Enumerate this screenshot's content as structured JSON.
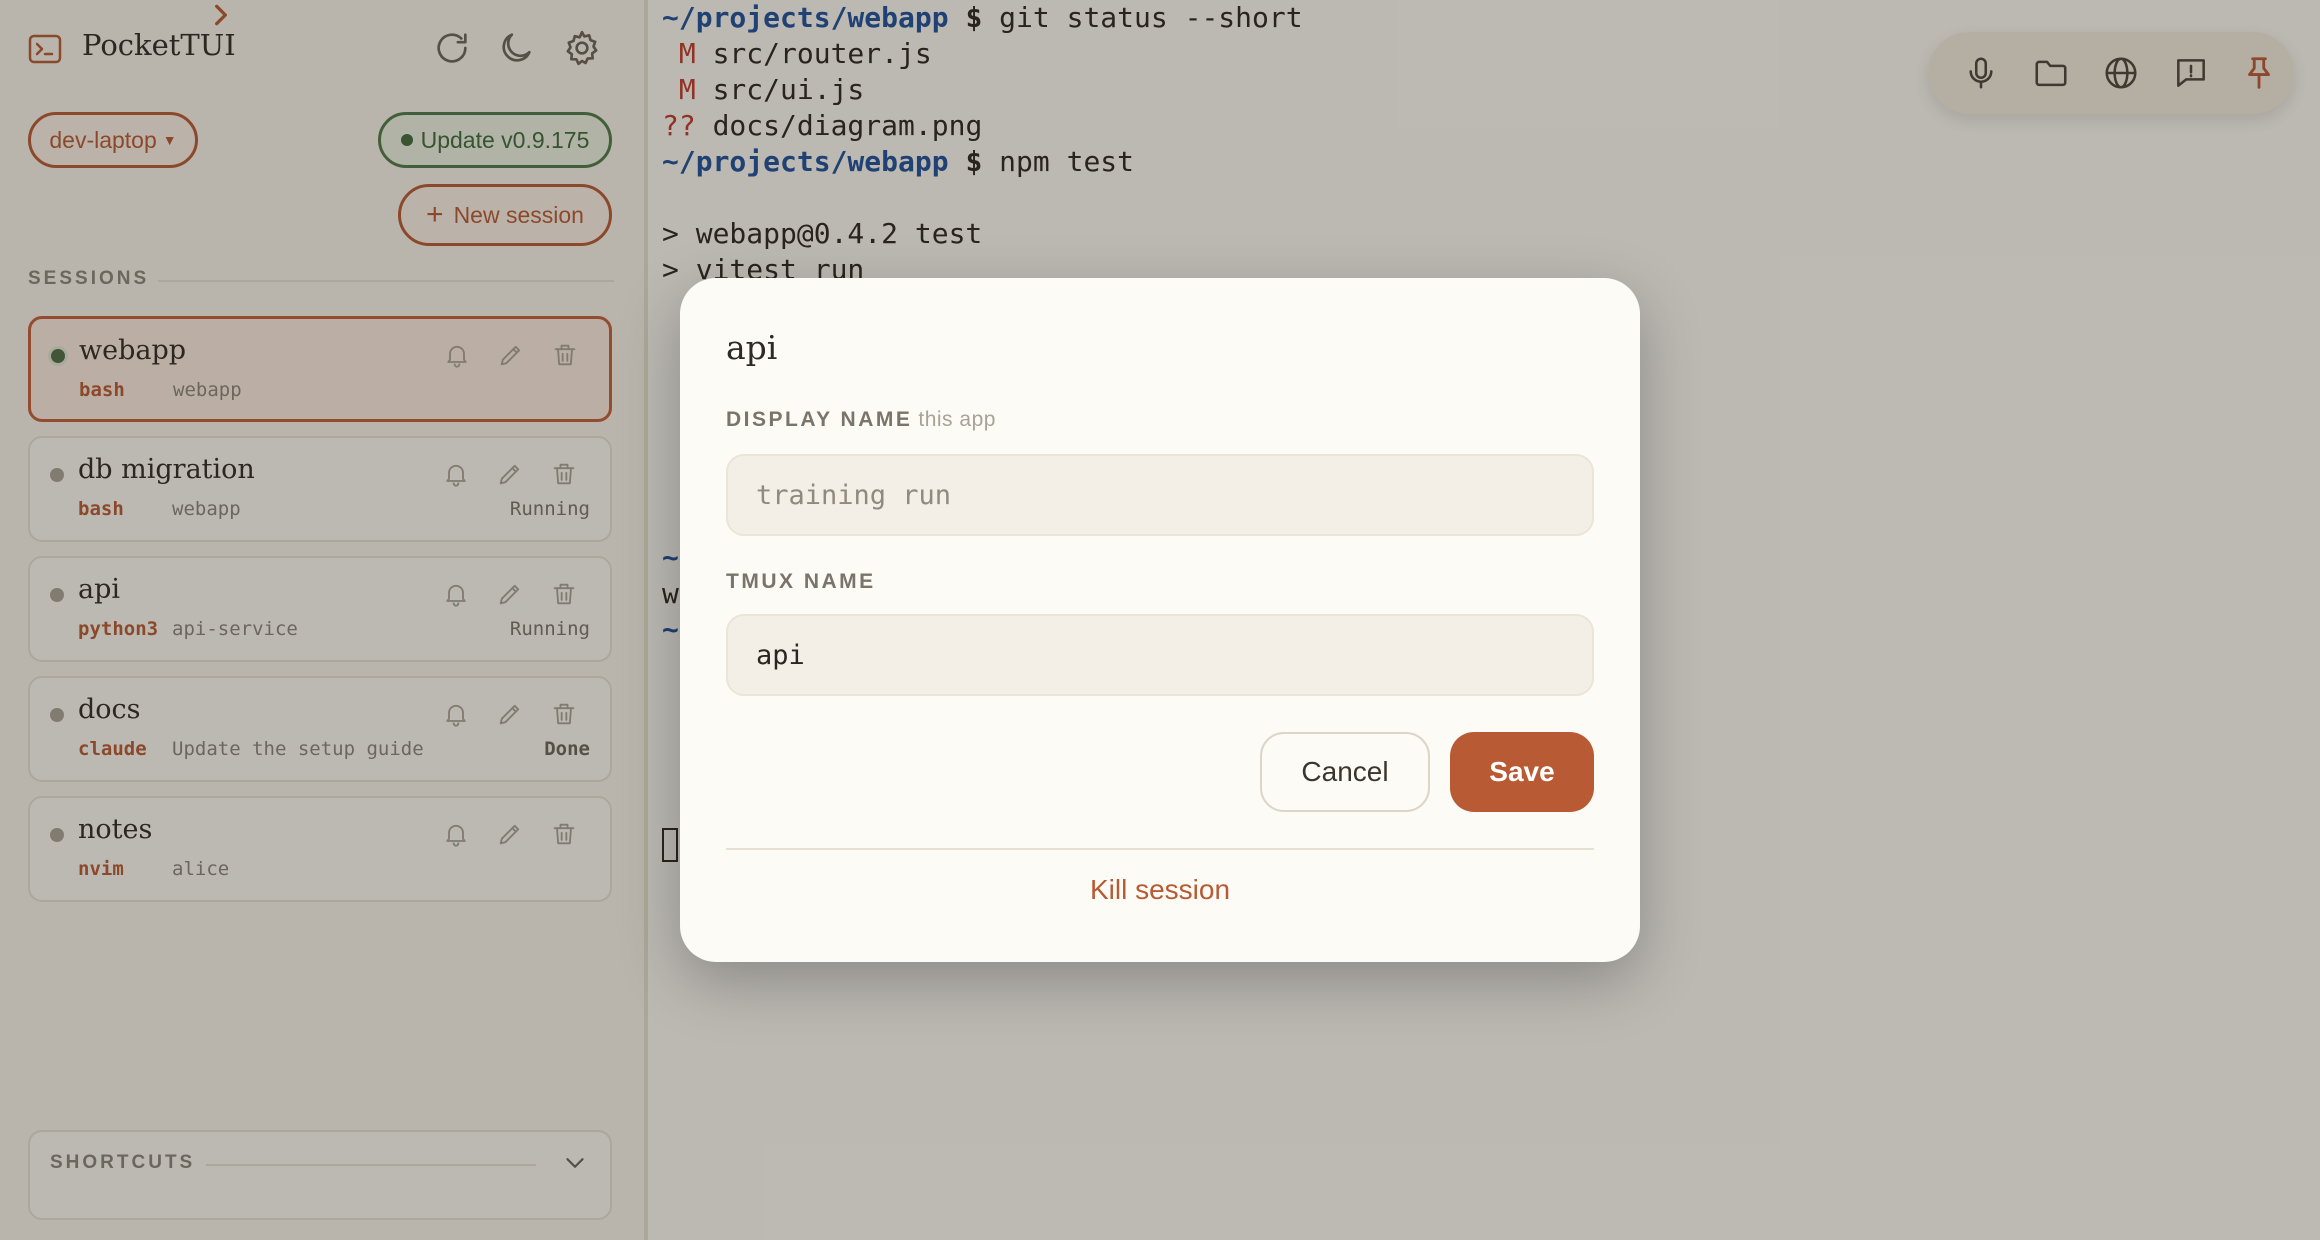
{
  "app": {
    "title": "PocketTUI",
    "icons": {
      "brand": "terminal-icon",
      "caret": "chevron-right-icon",
      "refresh": "refresh-icon",
      "theme": "moon-icon",
      "settings": "gear-icon"
    }
  },
  "host": {
    "label": "dev-laptop",
    "caret": "▼"
  },
  "update": {
    "label": "Update v0.9.175"
  },
  "new_session": {
    "plus": "+",
    "label": "New session"
  },
  "sessions_header": "SESSIONS",
  "sessions": [
    {
      "name": "webapp",
      "cmd": "bash",
      "dir": "webapp",
      "status": "",
      "active": true
    },
    {
      "name": "db migration",
      "cmd": "bash",
      "dir": "webapp",
      "status": "Running"
    },
    {
      "name": "api",
      "cmd": "python3",
      "dir": "api-service",
      "status": "Running"
    },
    {
      "name": "docs",
      "cmd": "claude",
      "dir": "Update the setup guide",
      "status": "Done"
    },
    {
      "name": "notes",
      "cmd": "nvim",
      "dir": "alice",
      "status": ""
    }
  ],
  "shortcuts": {
    "label": "SHORTCUTS"
  },
  "terminal": {
    "line1": {
      "prompt": "~/projects/webapp",
      "dollar": "$",
      "cmd": " git status --short"
    },
    "line2": {
      "flag": " M",
      "text": " src/router.js"
    },
    "line3": {
      "flag": " M",
      "text": " src/ui.js"
    },
    "line4": {
      "flag": "??",
      "text": " docs/diagram.png"
    },
    "line5": {
      "prompt": "~/projects/webapp",
      "dollar": "$",
      "cmd": " npm test"
    },
    "line6": "> webapp@0.4.2 test",
    "line7": "> vitest run",
    "frag_tilde": "~",
    "frag_w": "w"
  },
  "toolbar": {
    "icons": [
      "microphone-icon",
      "folder-icon",
      "globe-icon",
      "feedback-icon",
      "pin-icon"
    ]
  },
  "colors": {
    "accent": "#b85a34",
    "update_green": "#3d6a3a",
    "prompt_blue": "#1c4f9c"
  },
  "modal": {
    "title": "api",
    "display_name_label": "DISPLAY NAME",
    "display_name_hint": "this app",
    "display_name_placeholder": "training run",
    "tmux_label": "TMUX NAME",
    "tmux_value": "api",
    "cancel": "Cancel",
    "save": "Save",
    "kill": "Kill session"
  }
}
